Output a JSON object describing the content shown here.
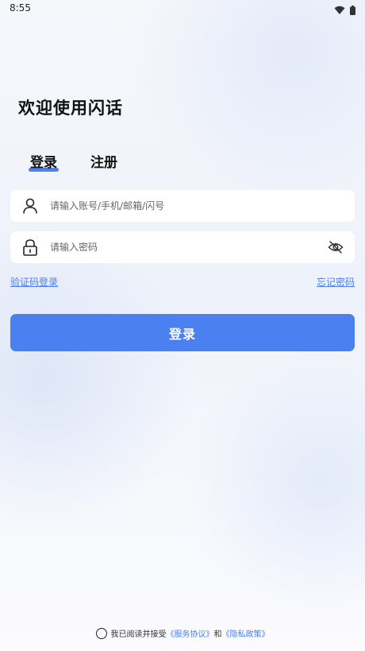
{
  "status_bar": {
    "time": "8:55",
    "icons": [
      "wifi-icon",
      "battery-icon"
    ]
  },
  "welcome": {
    "title": "欢迎使用闪话"
  },
  "tabs": [
    {
      "label": "登录",
      "active": true
    },
    {
      "label": "注册",
      "active": false
    }
  ],
  "account_field": {
    "placeholder": "请输入账号/手机/邮箱/闪号",
    "value": "",
    "icon": "user-icon"
  },
  "password_field": {
    "placeholder": "请输入密码",
    "value": "",
    "icon": "lock-icon",
    "toggle_icon": "eye-off-icon"
  },
  "links": {
    "code_login": "验证码登录",
    "forgot_password": "忘记密码"
  },
  "login_button": {
    "label": "登录"
  },
  "agreement": {
    "prefix": "我已阅读并接受",
    "terms_link": "《服务协议》",
    "conjunction": "和",
    "privacy_link": "《隐私政策》",
    "checked": false
  },
  "colors": {
    "accent": "#4a80ef",
    "field_background": "#ffffff",
    "text_primary": "#111111"
  }
}
